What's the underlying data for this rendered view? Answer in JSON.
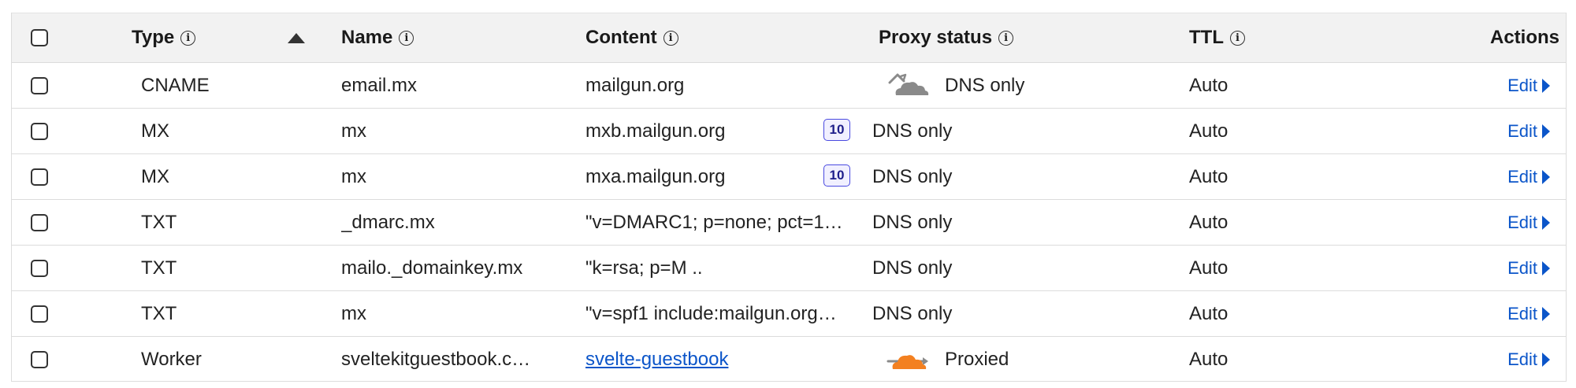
{
  "header": {
    "type": "Type",
    "name": "Name",
    "content": "Content",
    "proxy_status": "Proxy status",
    "ttl": "TTL",
    "actions": "Actions"
  },
  "info_glyph": "i",
  "records": [
    {
      "type": "CNAME",
      "name": "email.mx",
      "content": "mailgun.org",
      "priority": "",
      "proxy_status": "DNS only",
      "proxy_icon": "cloud-dns-only-icon",
      "ttl": "Auto",
      "action": "Edit"
    },
    {
      "type": "MX",
      "name": "mx",
      "content": "mxb.mailgun.org",
      "priority": "10",
      "proxy_status": "DNS only",
      "proxy_icon": "",
      "ttl": "Auto",
      "action": "Edit"
    },
    {
      "type": "MX",
      "name": "mx",
      "content": "mxa.mailgun.org",
      "priority": "10",
      "proxy_status": "DNS only",
      "proxy_icon": "",
      "ttl": "Auto",
      "action": "Edit"
    },
    {
      "type": "TXT",
      "name": "_dmarc.mx",
      "content": "\"v=DMARC1; p=none; pct=1…",
      "priority": "",
      "proxy_status": "DNS only",
      "proxy_icon": "",
      "ttl": "Auto",
      "action": "Edit"
    },
    {
      "type": "TXT",
      "name": "mailo._domainkey.mx",
      "content": "\"k=rsa; p=M          ..",
      "priority": "",
      "proxy_status": "DNS only",
      "proxy_icon": "",
      "ttl": "Auto",
      "action": "Edit"
    },
    {
      "type": "TXT",
      "name": "mx",
      "content": "\"v=spf1 include:mailgun.org…",
      "priority": "",
      "proxy_status": "DNS only",
      "proxy_icon": "",
      "ttl": "Auto",
      "action": "Edit"
    },
    {
      "type": "Worker",
      "name": "sveltekitguestbook.c…",
      "content": "svelte-guestbook",
      "priority": "",
      "proxy_status": "Proxied",
      "proxy_icon": "cloud-proxied-icon",
      "ttl": "Auto",
      "action": "Edit"
    }
  ],
  "colors": {
    "link": "#0b55c9",
    "dns_only_cloud": "#8a8a8a",
    "proxied_cloud": "#f38020",
    "header_bg": "#f2f2f2",
    "badge_border": "#4a4ae0"
  }
}
